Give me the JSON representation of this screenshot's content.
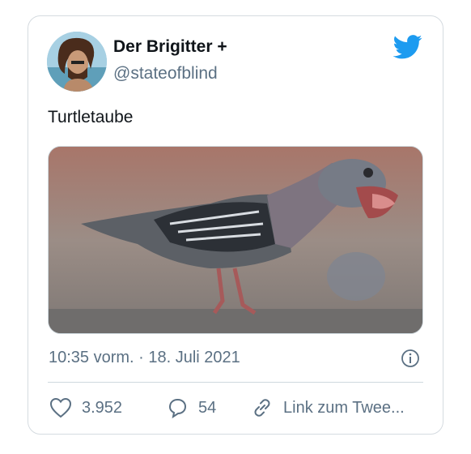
{
  "user": {
    "display_name": "Der Brigitter +",
    "handle": "@stateofblind"
  },
  "tweet": {
    "text": "Turtletaube",
    "timestamp": "10:35 vorm. · 18. Juli 2021"
  },
  "actions": {
    "likes": "3.952",
    "replies": "54",
    "link_label": "Link zum Twee..."
  },
  "colors": {
    "twitter_blue": "#1d9bf0",
    "secondary_text": "#5b7083",
    "border": "#d5dbe0"
  },
  "icons": [
    "twitter-bird-icon",
    "info-icon",
    "heart-icon",
    "reply-bubble-icon",
    "link-icon"
  ]
}
